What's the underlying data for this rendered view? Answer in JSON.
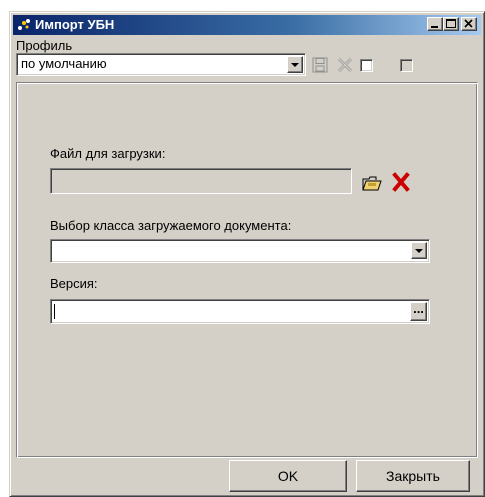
{
  "window": {
    "title": "Импорт УБН",
    "minimize_icon": "minimize-icon",
    "maximize_icon": "maximize-icon",
    "close_icon": "close-icon"
  },
  "profile": {
    "label": "Профиль",
    "selected": "по умолчанию",
    "save_icon": "save-icon",
    "delete_icon": "delete-icon"
  },
  "file": {
    "label": "Файл для загрузки:",
    "value": "",
    "open_icon": "open-folder-icon",
    "clear_icon": "clear-x-icon"
  },
  "doc_class": {
    "label": "Выбор класса загружаемого документа:",
    "selected": ""
  },
  "version": {
    "label": "Версия:",
    "value": "",
    "ellipsis": "..."
  },
  "buttons": {
    "ok": "OK",
    "close": "Закрыть"
  },
  "colors": {
    "title_gradient_start": "#0a246a",
    "face": "#d4d0c8",
    "clear_red": "#cc0000"
  }
}
